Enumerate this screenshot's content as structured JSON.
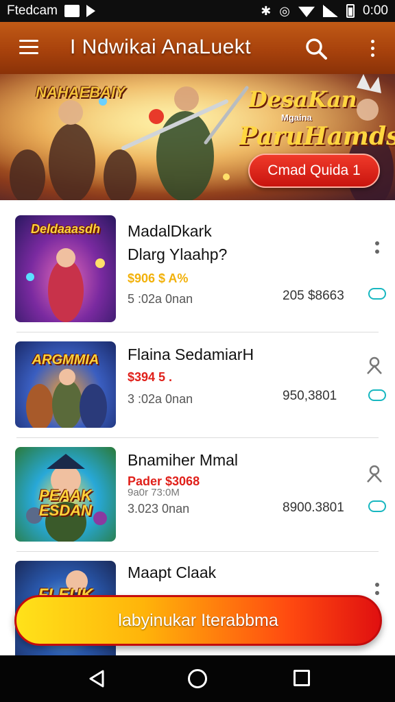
{
  "status_bar": {
    "carrier": "Ftedcam",
    "time": "0:00",
    "icons": [
      "image-icon",
      "play-store-icon",
      "bluetooth-icon",
      "alarm-icon",
      "wifi-icon",
      "signal-icon",
      "battery-icon"
    ]
  },
  "app_bar": {
    "title": "I Ndwikai AnaLuekt",
    "icons": [
      "menu-icon",
      "search-icon",
      "more-vert-icon"
    ]
  },
  "hero": {
    "logo_text": "NAHAEBAIY",
    "title_line1": "DesaKan",
    "title_line2": "Mgaina",
    "title_line3": "ParuHamds",
    "cta_label": "Cmad Quida 1"
  },
  "items": [
    {
      "thumb_text": "Deldaaasdh",
      "name": "MadalDkark",
      "subtitle": "Dlarg Ylaahp?",
      "price": "$906 $ A%",
      "price_color": "#f2b10a",
      "meta": "5 :02a 0nan",
      "count": "205 $8663",
      "action_icon": "more-vert-icon"
    },
    {
      "thumb_text": "ARGMMIA",
      "name": "Flaina SedamiarH",
      "subtitle": "",
      "price": "$394 5 .",
      "price_color": "#e0201a",
      "meta": "3 :02a 0nan",
      "count": "950,3801",
      "action_icon": "person-icon"
    },
    {
      "thumb_text": "PEAAK ESDAN",
      "name": "Bnamiher Mmal",
      "subtitle": "",
      "price": "Pader $3068",
      "price_color": "#e0201a",
      "price_extra": "9a0r 73:0M",
      "meta": "3.023 0nan",
      "count": "8900.3801",
      "action_icon": "person-icon"
    },
    {
      "thumb_text": "FLEUK",
      "name": "Maapt Claak",
      "subtitle": "",
      "price": "",
      "price_color": "#e0201a",
      "meta": "",
      "count": "",
      "action_icon": "more-vert-icon"
    }
  ],
  "cta": {
    "label": "labyinukar Iterabbma",
    "gradient_start": "#ffe21a",
    "gradient_end": "#e01010"
  },
  "colors": {
    "app_bar": "#a8420c",
    "accent_teal": "#17b7c0",
    "price_yellow": "#f2b10a",
    "price_red": "#e0201a"
  }
}
